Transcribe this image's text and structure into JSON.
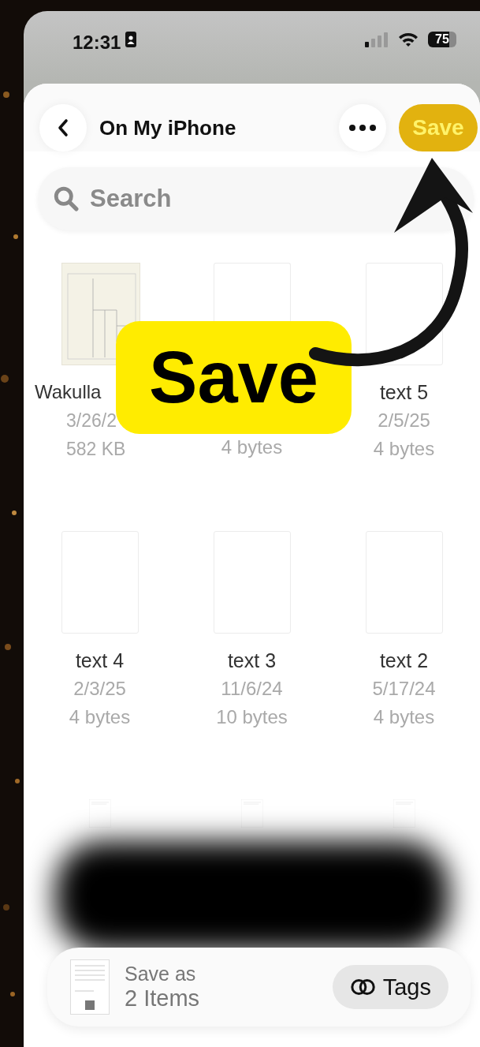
{
  "status_bar": {
    "time": "12:31",
    "battery": "75"
  },
  "header": {
    "title": "On My iPhone",
    "save_button": "Save"
  },
  "search": {
    "placeholder": "Search"
  },
  "files": [
    {
      "kind": "map",
      "name": "Wakulla",
      "date": "3/26/2",
      "size": "582 KB"
    },
    {
      "kind": "blank",
      "size": "4 bytes"
    },
    {
      "kind": "blank",
      "name": "text 5",
      "date": "2/5/25",
      "size": "4 bytes"
    },
    {
      "kind": "blank",
      "name": "text 4",
      "date": "2/3/25",
      "size": "4 bytes"
    },
    {
      "kind": "blank",
      "name": "text 3",
      "date": "11/6/24",
      "size": "10 bytes"
    },
    {
      "kind": "blank",
      "name": "text 2",
      "date": "5/17/24",
      "size": "4 bytes"
    },
    {
      "kind": "document"
    },
    {
      "kind": "document"
    },
    {
      "kind": "document"
    }
  ],
  "save_bar": {
    "label": "Save as",
    "count": "2 Items",
    "tags_button": "Tags"
  },
  "callout": {
    "text": "Save"
  }
}
